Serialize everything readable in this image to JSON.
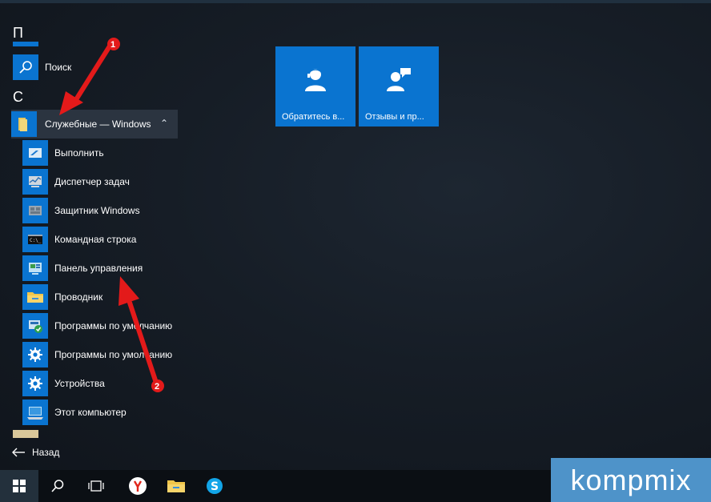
{
  "start_menu": {
    "section_p": "П",
    "search_item": "Поиск",
    "section_c": "С",
    "group_header": "Служебные — Windows",
    "items": [
      "Выполнить",
      "Диспетчер задач",
      "Защитник Windows",
      "Командная строка",
      "Панель управления",
      "Проводник",
      "Программы по умолчанию",
      "Программы по умолчанию",
      "Устройства",
      "Этот компьютер"
    ],
    "back_label": "Назад"
  },
  "tiles": [
    {
      "label": "Обратитесь в..."
    },
    {
      "label": "Отзывы и пр..."
    }
  ],
  "annotations": {
    "badge_1": "1",
    "badge_2": "2",
    "arrow_color": "#e31a1a"
  },
  "watermark": "kompmix",
  "colors": {
    "accent": "#0a74d0",
    "group_bg": "#2b3440",
    "taskbar_bg": "#0b0f14"
  }
}
